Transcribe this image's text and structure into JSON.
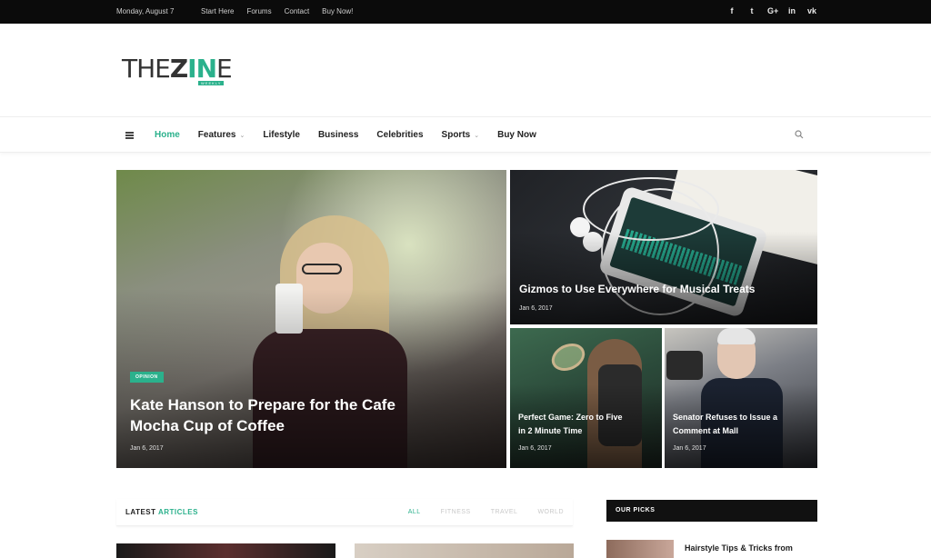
{
  "topbar": {
    "date": "Monday, August 7",
    "links": [
      "Start Here",
      "Forums",
      "Contact",
      "Buy Now!"
    ],
    "social": [
      {
        "icon": "facebook-icon",
        "glyph": "f"
      },
      {
        "icon": "twitter-icon",
        "glyph": "t"
      },
      {
        "icon": "google-plus-icon",
        "glyph": "G+"
      },
      {
        "icon": "linkedin-icon",
        "glyph": "in"
      },
      {
        "icon": "vk-icon",
        "glyph": "vk"
      }
    ]
  },
  "logo": {
    "part1": "THE",
    "part2": "Z",
    "part3": "IN",
    "part4": "E",
    "tag": "WEEKLY"
  },
  "nav": {
    "items": [
      "Home",
      "Features",
      "Lifestyle",
      "Business",
      "Celebrities",
      "Sports",
      "Buy Now"
    ],
    "active": "Home"
  },
  "hero": {
    "main": {
      "badge": "OPINION",
      "title_line1": "Kate Hanson to Prepare for the Cafe",
      "title_line2": "Mocha Cup of Coffee",
      "date": "Jan 6, 2017"
    },
    "top_right": {
      "title": "Gizmos to Use Everywhere for Musical Treats",
      "date": "Jan 6, 2017"
    },
    "bottom_left": {
      "title_line1": "Perfect Game: Zero to Five",
      "title_line2": "in 2 Minute Time",
      "date": "Jan 6, 2017"
    },
    "bottom_right": {
      "title_line1": "Senator Refuses to Issue a",
      "title_line2": "Comment at Mall",
      "date": "Jan 6, 2017"
    }
  },
  "latest": {
    "heading_part1": "LATEST",
    "heading_part2": "ARTICLES",
    "filters": [
      "ALL",
      "FITNESS",
      "TRAVEL",
      "WORLD"
    ],
    "active_filter": "ALL"
  },
  "picks": {
    "heading": "OUR PICKS",
    "item_title": "Hairstyle Tips & Tricks from"
  },
  "colors": {
    "accent": "#2bb18c",
    "topbar": "#0b0b0b"
  }
}
